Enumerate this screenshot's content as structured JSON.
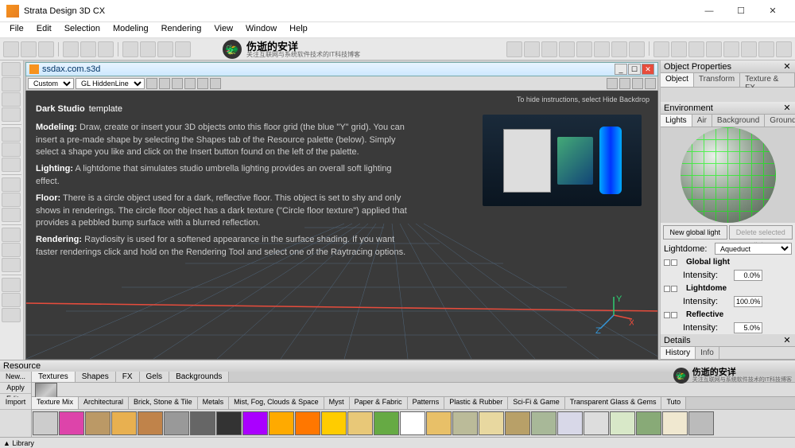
{
  "app": {
    "title": "Strata Design 3D CX"
  },
  "menu": [
    "File",
    "Edit",
    "Selection",
    "Modeling",
    "Rendering",
    "View",
    "Window",
    "Help"
  ],
  "logo": {
    "cn": "伤逝的安详",
    "sub": "关注互联网与系统软件技术的IT科技博客"
  },
  "document": {
    "filename": "ssdax.com.s3d",
    "view_mode": "Custom",
    "shading": "GL HiddenLine"
  },
  "viewport": {
    "hide_hint": "To hide instructions, select Hide Backdrop",
    "title_bold": "Dark Studio",
    "title_rest": "template",
    "p1_lead": "Modeling:",
    "p1": " Draw, create or insert your 3D objects onto this floor grid (the blue \"Y\" grid). You can insert a pre-made shape by selecting the Shapes tab of the Resource palette (below). Simply select a shape you like and click on the Insert button found on the left of the palette.",
    "p2_lead": "Lighting:",
    "p2": " A lightdome that simulates studio umbrella lighting provides an overall soft lighting effect.",
    "p3_lead": "Floor:",
    "p3": " There is a circle object used for a dark, reflective floor. This object is set to shy and only shows in renderings. The circle floor object has a dark texture (\"Circle floor texture\") applied that provides a pebbled bump surface with a blurred reflection.",
    "p4_lead": "Rendering:",
    "p4": " Raydiosity is used for a softened appearance in the surface shading. If you want faster renderings click and hold on the Rendering Tool and select one of the Raytracing options.",
    "axes": {
      "x": "X",
      "y": "Y",
      "z": "Z"
    }
  },
  "obj_props": {
    "title": "Object Properties",
    "tabs": [
      "Object",
      "Transform",
      "Texture & FX"
    ]
  },
  "env": {
    "title": "Environment",
    "tabs": [
      "Lights",
      "Air",
      "Background",
      "Ground"
    ],
    "new_light": "New global light",
    "del_light": "Delete selected light",
    "ld_label": "Lightdome:",
    "ld_value": "Aqueduct",
    "gl_label": "Global light",
    "gl_int_label": "Intensity:",
    "gl_int": "0.0%",
    "ldome_label": "Lightdome",
    "ld_int_label": "Intensity:",
    "ld_int": "100.0%",
    "refl_label": "Reflective",
    "refl_int_label": "Intensity:",
    "refl_int": "5.0%"
  },
  "details": {
    "title": "Details",
    "tabs": [
      "History",
      "Info"
    ]
  },
  "resource": {
    "title": "Resource",
    "side": [
      "New...",
      "Apply",
      "Edit..."
    ],
    "import": "Import",
    "tabs": [
      "Textures",
      "Shapes",
      "FX",
      "Gels",
      "Backgrounds"
    ],
    "lib_tabs": [
      "Texture Mix",
      "Architectural",
      "Brick, Stone & Tile",
      "Metals",
      "Mist, Fog, Clouds & Space",
      "Myst",
      "Paper & Fabric",
      "Patterns",
      "Plastic & Rubber",
      "Sci-Fi & Game",
      "Transparent Glass & Gems",
      "Tuto"
    ],
    "lib_foot": "▲ Library"
  },
  "swatch_colors": [
    "#ccc",
    "#d4a",
    "#b96",
    "#e8b050",
    "#c0834a",
    "#999",
    "#666",
    "#333",
    "#a0f",
    "#fa0",
    "#f70",
    "#fc0",
    "#e8c878",
    "#6a4",
    "#fff",
    "#e8c068",
    "#bb9",
    "#e8d8a0",
    "#b8a068",
    "#a8b898",
    "#d8d8e8",
    "#ddd",
    "#d8e8c8",
    "#8a7",
    "#f0e8d0",
    "#bbb"
  ]
}
